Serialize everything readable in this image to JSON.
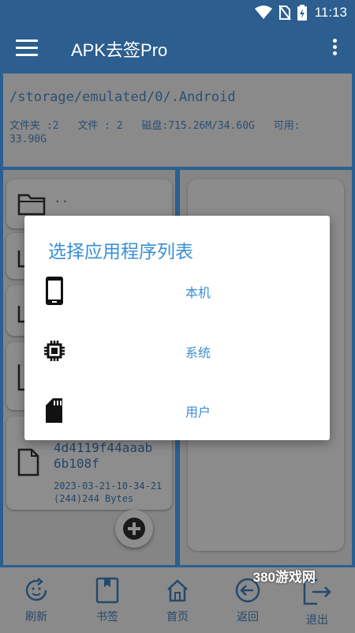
{
  "status_bar": {
    "time": "11:13",
    "icons": [
      "wifi-icon",
      "no-sim-icon",
      "battery-charging-icon"
    ]
  },
  "app_bar": {
    "title": "APK去签Pro",
    "menu_icon": "hamburger-menu-icon",
    "more_icon": "more-vert-icon"
  },
  "path_panel": {
    "path": "/storage/emulated/0/.Android",
    "folder_count": "文件夹 :2",
    "file_count": "文件 : 2",
    "disk": "磁盘:715.26M/34.60G",
    "available_label": "可用:",
    "available_value": "33.90G"
  },
  "file_list": [
    {
      "icon": "folder-icon",
      "name": ".."
    },
    {
      "icon": "file-icon",
      "name": "4d4119f44aaab\n6b108f",
      "date": "2023-03-21-10-34-21",
      "size": "(244)244 Bytes"
    }
  ],
  "fab": {
    "icon": "add-circle-icon"
  },
  "dialog": {
    "title": "选择应用程序列表",
    "options": [
      {
        "icon": "phone-icon",
        "label": "本机"
      },
      {
        "icon": "chip-icon",
        "label": "系统"
      },
      {
        "icon": "sd-card-icon",
        "label": "用户"
      }
    ]
  },
  "bottom_nav": [
    {
      "icon": "refresh-face-icon",
      "label": "刷新"
    },
    {
      "icon": "bookmark-icon",
      "label": "书签"
    },
    {
      "icon": "home-icon",
      "label": "首页"
    },
    {
      "icon": "back-arrow-icon",
      "label": "返回"
    },
    {
      "icon": "exit-icon",
      "label": "退出"
    }
  ],
  "watermark": "380游戏网",
  "colors": {
    "primary": "#2c5e8f",
    "accent": "#3a8fd6",
    "text_dark": "#23476a",
    "dim_overlay": "#8a8a8a"
  }
}
